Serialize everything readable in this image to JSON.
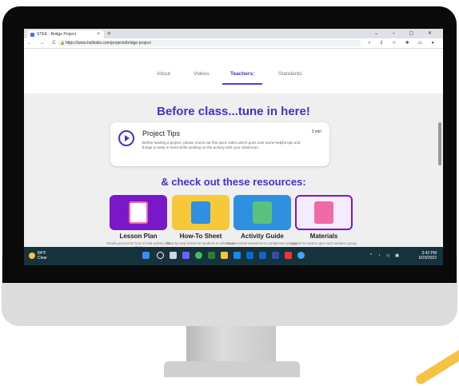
{
  "browser": {
    "tab_title": "STEK - Bridge Project",
    "tab_close": "×",
    "new_tab": "+",
    "window_controls": "⌄ – ▢ ✕",
    "nav_controls": "← → C",
    "url": "https://www.hellostix.com/projects/bridge-project",
    "toolbar_icons": "⌕ ⇪ ☆ ✱ ▭ ●"
  },
  "page": {
    "nav_tabs": [
      "About",
      "Videos",
      "Teachers:",
      "Standards"
    ],
    "active_tab": "Teachers:",
    "heading1": "Before class...tune in here!",
    "tip_card": {
      "title": "Project Tips",
      "description": "Before leading a project, please check out this quick video which goes over some helpful tips and things to keep in mind while working on the activity with your classroom.",
      "duration": "3 min"
    },
    "heading2": "& check out these resources:",
    "resources": [
      {
        "title": "Lesson Plan",
        "description": "Details process for how to lead activity with class.",
        "color": "#7a17c9"
      },
      {
        "title": "How-To Sheet",
        "description": "Step-by-step sheets for students to reference.",
        "color": "#f7c83a"
      },
      {
        "title": "Activity Guide",
        "description": "Supplemental worksheet to complement project.",
        "color": "#2f8fe0"
      },
      {
        "title": "Materials",
        "description": "A guide for what to give each student / group.",
        "color": "#f4ecfc"
      }
    ]
  },
  "taskbar": {
    "temp": "84°F",
    "weather": "Clear",
    "time": "3:42 PM",
    "date": "6/29/2022"
  },
  "colors": {
    "accent": "#4a2fc4",
    "taskbar": "#16323d"
  }
}
